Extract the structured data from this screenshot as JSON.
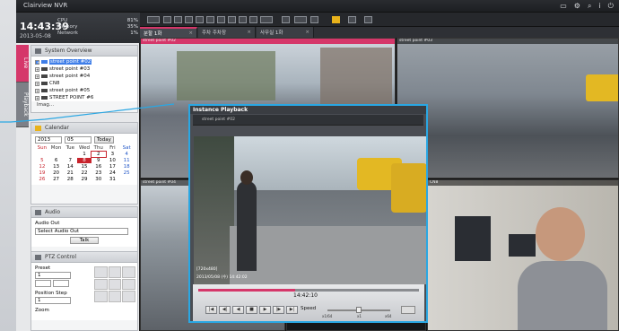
{
  "app": {
    "title": "Clairview NVR"
  },
  "status": {
    "time": "14:43:39",
    "date": "2013-05-08",
    "meters": [
      {
        "label": "CPU",
        "value": "81%"
      },
      {
        "label": "Memory",
        "value": "35%"
      },
      {
        "label": "Network",
        "value": "1%"
      }
    ]
  },
  "sidetabs": {
    "live": "Live",
    "playback": "Playback"
  },
  "system_overview": {
    "title": "System Overview",
    "items": [
      "street point #02",
      "street point #03",
      "street point #04",
      "CN8",
      "street point #05",
      "STREET POINT #6"
    ],
    "more": "Imag..."
  },
  "calendar": {
    "title": "Calendar",
    "year": "2013",
    "month": "05",
    "today": "Today",
    "days": [
      "Sun",
      "Mon",
      "Tue",
      "Wed",
      "Thu",
      "Fri",
      "Sat"
    ],
    "rows": [
      [
        "",
        "",
        "",
        "1",
        "2",
        "3",
        "4"
      ],
      [
        "5",
        "6",
        "7",
        "8",
        "9",
        "10",
        "11"
      ],
      [
        "12",
        "13",
        "14",
        "15",
        "16",
        "17",
        "18"
      ],
      [
        "19",
        "20",
        "21",
        "22",
        "23",
        "24",
        "25"
      ],
      [
        "26",
        "27",
        "28",
        "29",
        "30",
        "31",
        ""
      ]
    ],
    "selected": "8",
    "outlined": "2"
  },
  "audio": {
    "title": "Audio",
    "label": "Audio Out",
    "select": "Select Audio Out",
    "talk": "Talk"
  },
  "ptz": {
    "title": "PTZ Control",
    "preset": "Preset",
    "position_step": "Position Step",
    "zoom": "Zoom",
    "preset_value": "1",
    "step_value": "1"
  },
  "tabs": [
    {
      "label": "분할 1화"
    },
    {
      "label": "주차 주차장"
    },
    {
      "label": "사무실 1화"
    }
  ],
  "popup": {
    "title": "Instance Playback",
    "subtitle": "street point #02",
    "resolution": "[720x480]",
    "timestamp": "2013/05/08 (수) 14:42:02",
    "playtime": "14:42:10",
    "speed_label": "Speed",
    "speed_ticks": [
      "x1/64",
      "x1",
      "x64"
    ],
    "progress": 0.44
  },
  "cells": [
    {
      "label": "street point #02"
    },
    {
      "label": "street point #03"
    },
    {
      "label": "street point #04"
    },
    {
      "label": "CN8"
    },
    {
      "label": "street point #05"
    }
  ],
  "colors": {
    "accent": "#d5376a",
    "highlight_border": "#2aa7e3",
    "selected_tree": "#3f7ee8"
  }
}
